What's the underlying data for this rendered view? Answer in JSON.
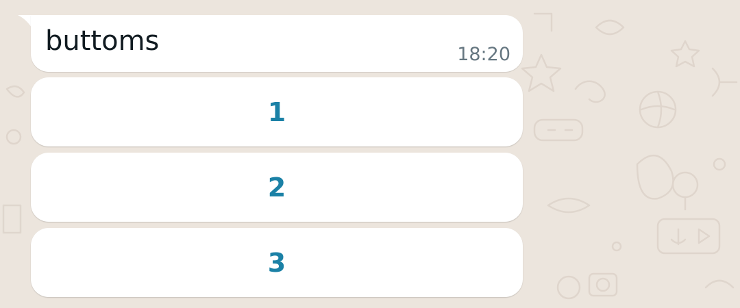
{
  "colors": {
    "chat_background": "#ECE5DD",
    "bubble": "#FFFFFF",
    "message_text": "#111B21",
    "timestamp": "#667781",
    "button_text": "#1B81A6"
  },
  "message": {
    "text": "buttoms",
    "time": "18:20"
  },
  "buttons": [
    {
      "label": "1"
    },
    {
      "label": "2"
    },
    {
      "label": "3"
    }
  ]
}
